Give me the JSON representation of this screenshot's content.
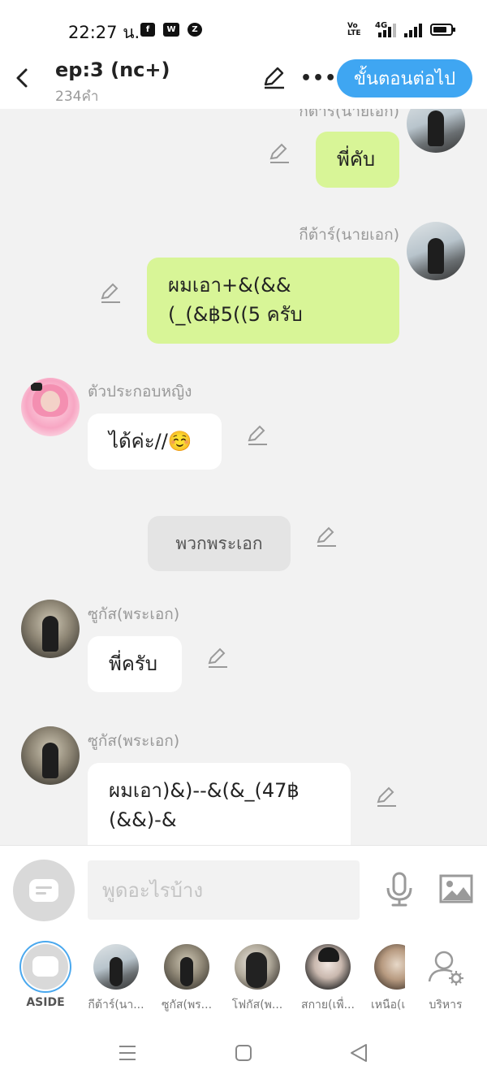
{
  "status_bar": {
    "time": "22:27 น.",
    "apps": [
      "f",
      "W",
      "Z"
    ],
    "volte": "Vo LTE",
    "network": "4G"
  },
  "header": {
    "title": "ep:3 (nc+)",
    "subtitle": "234คำ",
    "next_button": "ขั้นตอนต่อไป"
  },
  "messages": [
    {
      "type": "right",
      "name": "กีต้าร์(นายเอก)",
      "text": "พี่คับ"
    },
    {
      "type": "right",
      "name": "กีต้าร์(นายเอก)",
      "text": "ผมเอา+&(&&(_(&฿5((5 ครับ"
    },
    {
      "type": "left",
      "name": "ตัวประกอบหญิง",
      "text": "ได้ค่ะ//☺️"
    },
    {
      "type": "center",
      "text": "พวกพระเอก"
    },
    {
      "type": "left",
      "name": "ซูกัส(พระเอก)",
      "text": "พี่ครับ"
    },
    {
      "type": "left",
      "name": "ซูกัส(พระเอก)",
      "text": "ผมเอา)&)--&(&_(47฿ (&&)-&"
    }
  ],
  "composer": {
    "placeholder": "พูดอะไรบ้าง"
  },
  "characters": [
    {
      "label": "ASIDE"
    },
    {
      "label": "กีต้าร์(นา..."
    },
    {
      "label": "ซูกัส(พร..."
    },
    {
      "label": "โฟกัส(พ..."
    },
    {
      "label": "สกาย(เพื่..."
    },
    {
      "label": "เหนือ(เ"
    },
    {
      "label": "บริหาร"
    }
  ],
  "colors": {
    "accent": "#3fa6f2",
    "bubble_green": "#d8f597",
    "bubble_white": "#ffffff",
    "background": "#f2f2f2"
  }
}
